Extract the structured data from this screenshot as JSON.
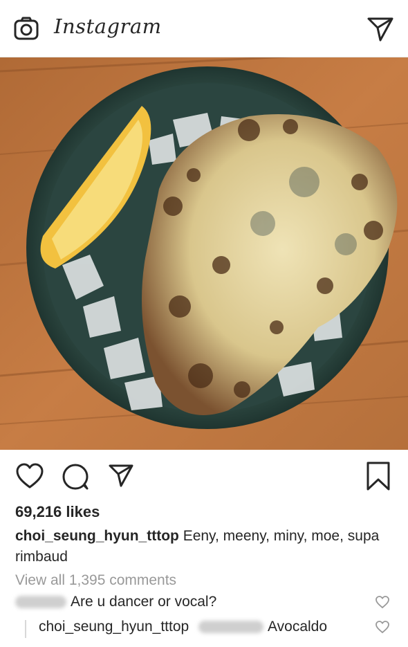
{
  "app": {
    "brand": "Instagram",
    "icons": {
      "camera": "camera-icon",
      "direct": "direct-message-icon",
      "like": "heart-icon",
      "comment": "comment-icon",
      "share": "share-icon",
      "save": "bookmark-icon"
    }
  },
  "post": {
    "likes": "69,216 likes",
    "caption_user": "choi_seung_hyun_tttop",
    "caption_text": " Eeny, meeny, miny, moe, supa rimbaud",
    "view_all": "View all 1,395 comments"
  },
  "comments": [
    {
      "text": "Are u dancer or vocal?"
    },
    {
      "user": "choi_seung_hyun_tttop",
      "text": "Avocaldo"
    }
  ]
}
